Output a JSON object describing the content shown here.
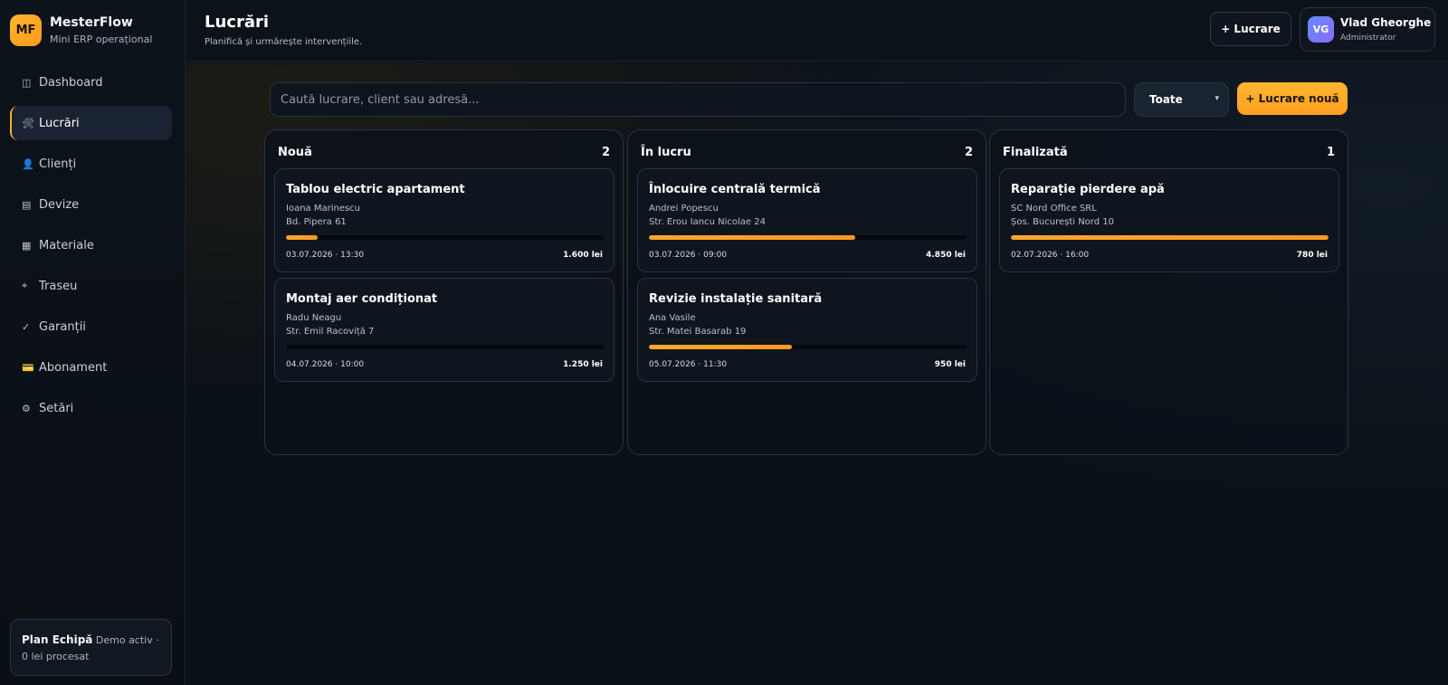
{
  "brand": {
    "logo": "MF",
    "name": "MesterFlow",
    "subtitle": "Mini ERP operațional"
  },
  "nav": [
    {
      "icon": "◫",
      "icon_name": "dashboard-icon",
      "label": "Dashboard",
      "active": false
    },
    {
      "icon": "🛠",
      "icon_name": "tools-icon",
      "label": "Lucrări",
      "active": true
    },
    {
      "icon": "👤",
      "icon_name": "user-icon",
      "label": "Clienți",
      "active": false
    },
    {
      "icon": "▤",
      "icon_name": "document-icon",
      "label": "Devize",
      "active": false
    },
    {
      "icon": "▦",
      "icon_name": "grid-icon",
      "label": "Materiale",
      "active": false
    },
    {
      "icon": "⌖",
      "icon_name": "route-icon",
      "label": "Traseu",
      "active": false
    },
    {
      "icon": "✓",
      "icon_name": "check-icon",
      "label": "Garanții",
      "active": false
    },
    {
      "icon": "💳",
      "icon_name": "card-icon",
      "label": "Abonament",
      "active": false
    },
    {
      "icon": "⚙",
      "icon_name": "gear-icon",
      "label": "Setări",
      "active": false
    }
  ],
  "plan": {
    "name": "Plan Echipă",
    "details": "Demo activ · 0 lei procesat"
  },
  "header": {
    "title": "Lucrări",
    "subtitle": "Planifică și urmărește intervențiile.",
    "add_button": "+ Lucrare",
    "user": {
      "initials": "VG",
      "name": "Vlad Gheorghe",
      "role": "Administrator"
    }
  },
  "toolbar": {
    "search_placeholder": "Caută lucrare, client sau adresă...",
    "filter_value": "Toate",
    "new_button": "+ Lucrare nouă"
  },
  "accent_color": "#ffab2b",
  "columns": [
    {
      "title": "Nouă",
      "count": "2",
      "cards": [
        {
          "title": "Tablou electric apartament",
          "client": "Ioana Marinescu",
          "address": "Bd. Pipera 61",
          "progress": 0.1,
          "date": "03.07.2026 · 13:30",
          "price": "1.600 lei"
        },
        {
          "title": "Montaj aer condiționat",
          "client": "Radu Neagu",
          "address": "Str. Emil Racoviță 7",
          "progress": 0,
          "date": "04.07.2026 · 10:00",
          "price": "1.250 lei"
        }
      ]
    },
    {
      "title": "În lucru",
      "count": "2",
      "cards": [
        {
          "title": "Înlocuire centrală termică",
          "client": "Andrei Popescu",
          "address": "Str. Erou Iancu Nicolae 24",
          "progress": 0.65,
          "date": "03.07.2026 · 09:00",
          "price": "4.850 lei"
        },
        {
          "title": "Revizie instalație sanitară",
          "client": "Ana Vasile",
          "address": "Str. Matei Basarab 19",
          "progress": 0.45,
          "date": "05.07.2026 · 11:30",
          "price": "950 lei"
        }
      ]
    },
    {
      "title": "Finalizată",
      "count": "1",
      "cards": [
        {
          "title": "Reparație pierdere apă",
          "client": "SC Nord Office SRL",
          "address": "Șos. București Nord 10",
          "progress": 1,
          "date": "02.07.2026 · 16:00",
          "price": "780 lei"
        }
      ]
    }
  ]
}
